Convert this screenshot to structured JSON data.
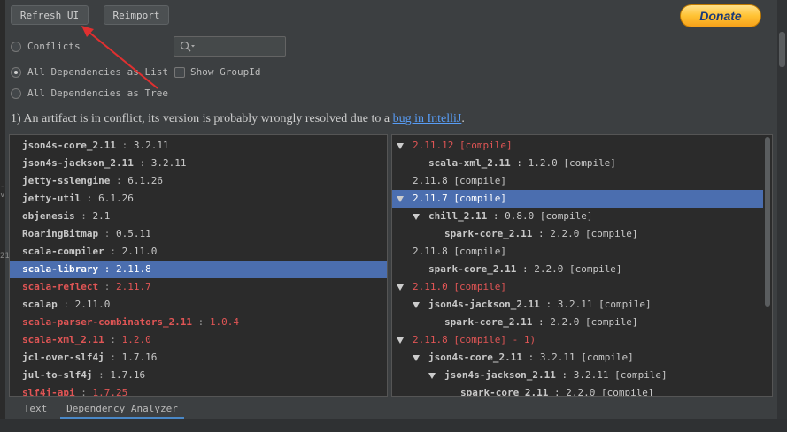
{
  "toolbar": {
    "refresh_label": "Refresh UI",
    "reimport_label": "Reimport",
    "donate_label": "Donate"
  },
  "options": {
    "conflicts": "Conflicts",
    "all_list": "All Dependencies as List",
    "all_tree": "All Dependencies as Tree",
    "show_groupid": "Show GroupId",
    "selected": "all_list"
  },
  "notice": {
    "text": "1) An artifact is in conflict, its version is probably wrongly resolved due to a ",
    "link": "bug in IntelliJ",
    "suffix": "."
  },
  "left_edge": {
    "mark1": "- v",
    "mark2": "21"
  },
  "dependencies": [
    {
      "name": "json4s-core_2.11",
      "sep": " : ",
      "version": "3.2.11",
      "conflict": false,
      "selected": false
    },
    {
      "name": "json4s-jackson_2.11",
      "sep": " : ",
      "version": "3.2.11",
      "conflict": false,
      "selected": false
    },
    {
      "name": "jetty-sslengine",
      "sep": " : ",
      "version": "6.1.26",
      "conflict": false,
      "selected": false
    },
    {
      "name": "jetty-util",
      "sep": " : ",
      "version": "6.1.26",
      "conflict": false,
      "selected": false
    },
    {
      "name": "objenesis",
      "sep": " : ",
      "version": "2.1",
      "conflict": false,
      "selected": false
    },
    {
      "name": "RoaringBitmap",
      "sep": " : ",
      "version": "0.5.11",
      "conflict": false,
      "selected": false
    },
    {
      "name": "scala-compiler",
      "sep": " : ",
      "version": "2.11.0",
      "conflict": false,
      "selected": false
    },
    {
      "name": "scala-library",
      "sep": " : ",
      "version": "2.11.8",
      "conflict": false,
      "selected": true
    },
    {
      "name": "scala-reflect",
      "sep": " : ",
      "version": "2.11.7",
      "conflict": true,
      "selected": false
    },
    {
      "name": "scalap",
      "sep": " : ",
      "version": "2.11.0",
      "conflict": false,
      "selected": false
    },
    {
      "name": "scala-parser-combinators_2.11",
      "sep": " : ",
      "version": "1.0.4",
      "conflict": true,
      "selected": false
    },
    {
      "name": "scala-xml_2.11",
      "sep": " : ",
      "version": "1.2.0",
      "conflict": true,
      "selected": false
    },
    {
      "name": "jcl-over-slf4j",
      "sep": " : ",
      "version": "1.7.16",
      "conflict": false,
      "selected": false
    },
    {
      "name": "jul-to-slf4j",
      "sep": " : ",
      "version": "1.7.16",
      "conflict": false,
      "selected": false
    },
    {
      "name": "slf4j-api",
      "sep": " : ",
      "version": "1.7.25",
      "conflict": true,
      "selected": false
    }
  ],
  "tree": [
    {
      "level": 0,
      "expand": true,
      "name": "",
      "sep": "",
      "version": "2.11.12 [compile]",
      "red": true,
      "selected": false
    },
    {
      "level": 1,
      "expand": false,
      "name": "scala-xml_2.11",
      "sep": " : ",
      "version": "1.2.0 [compile]",
      "red": false,
      "selected": false
    },
    {
      "level": 0,
      "expand": false,
      "name": "",
      "sep": "",
      "version": "2.11.8 [compile]",
      "red": false,
      "selected": false
    },
    {
      "level": 0,
      "expand": true,
      "name": "",
      "sep": "",
      "version": "2.11.7 [compile]",
      "red": false,
      "selected": true
    },
    {
      "level": 1,
      "expand": true,
      "name": "chill_2.11",
      "sep": " : ",
      "version": "0.8.0 [compile]",
      "red": false,
      "selected": false
    },
    {
      "level": 2,
      "expand": false,
      "name": "spark-core_2.11",
      "sep": " : ",
      "version": "2.2.0 [compile]",
      "red": false,
      "selected": false
    },
    {
      "level": 0,
      "expand": false,
      "name": "",
      "sep": "",
      "version": "2.11.8 [compile]",
      "red": false,
      "selected": false
    },
    {
      "level": 1,
      "expand": false,
      "name": "spark-core_2.11",
      "sep": " : ",
      "version": "2.2.0 [compile]",
      "red": false,
      "selected": false
    },
    {
      "level": 0,
      "expand": true,
      "name": "",
      "sep": "",
      "version": "2.11.0 [compile]",
      "red": true,
      "selected": false
    },
    {
      "level": 1,
      "expand": true,
      "name": "json4s-jackson_2.11",
      "sep": " : ",
      "version": "3.2.11 [compile]",
      "red": false,
      "selected": false
    },
    {
      "level": 2,
      "expand": false,
      "name": "spark-core_2.11",
      "sep": " : ",
      "version": "2.2.0 [compile]",
      "red": false,
      "selected": false
    },
    {
      "level": 0,
      "expand": true,
      "name": "",
      "sep": "",
      "version": "2.11.8 [compile] - 1)",
      "red": true,
      "selected": false
    },
    {
      "level": 1,
      "expand": true,
      "name": "json4s-core_2.11",
      "sep": " : ",
      "version": "3.2.11 [compile]",
      "red": false,
      "selected": false
    },
    {
      "level": 2,
      "expand": true,
      "name": "json4s-jackson_2.11",
      "sep": " : ",
      "version": "3.2.11 [compile]",
      "red": false,
      "selected": false
    },
    {
      "level": 3,
      "expand": false,
      "name": "spark-core_2.11",
      "sep": " : ",
      "version": "2.2.0 [compile]",
      "red": false,
      "selected": false
    }
  ],
  "tabs": [
    {
      "label": "Text",
      "active": false
    },
    {
      "label": "Dependency Analyzer",
      "active": true
    }
  ],
  "colors": {
    "background": "#3c3f41",
    "panel": "#2b2b2b",
    "selection": "#4b6eaf",
    "conflict": "#e05555",
    "link": "#589df6",
    "annotation_arrow": "#e03030"
  }
}
